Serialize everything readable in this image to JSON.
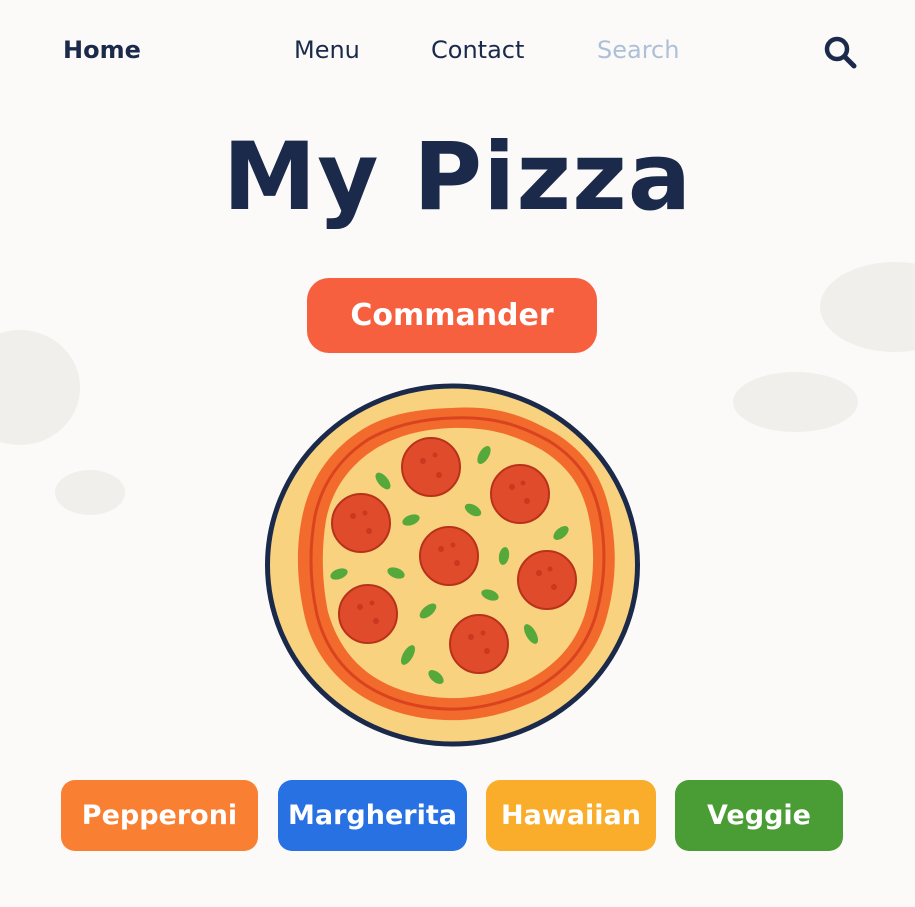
{
  "nav": {
    "home": "Home",
    "menu": "Menu",
    "contact": "Contact",
    "search": "Search",
    "search_icon": "search-icon"
  },
  "hero": {
    "title": "My Pizza",
    "order_button": "Commander"
  },
  "pizza_image": {
    "icon": "pizza-illustration"
  },
  "chips": [
    {
      "label": "Pepperoni",
      "color": "#f97f33"
    },
    {
      "label": "Margherita",
      "color": "#2771e3"
    },
    {
      "label": "Hawaiian",
      "color": "#f9ad2a"
    },
    {
      "label": "Veggie",
      "color": "#4a9c35"
    }
  ],
  "colors": {
    "background": "#fbfaf8",
    "text": "#1b2a4a",
    "accent": "#f6603f",
    "muted": "#aebfd8"
  }
}
